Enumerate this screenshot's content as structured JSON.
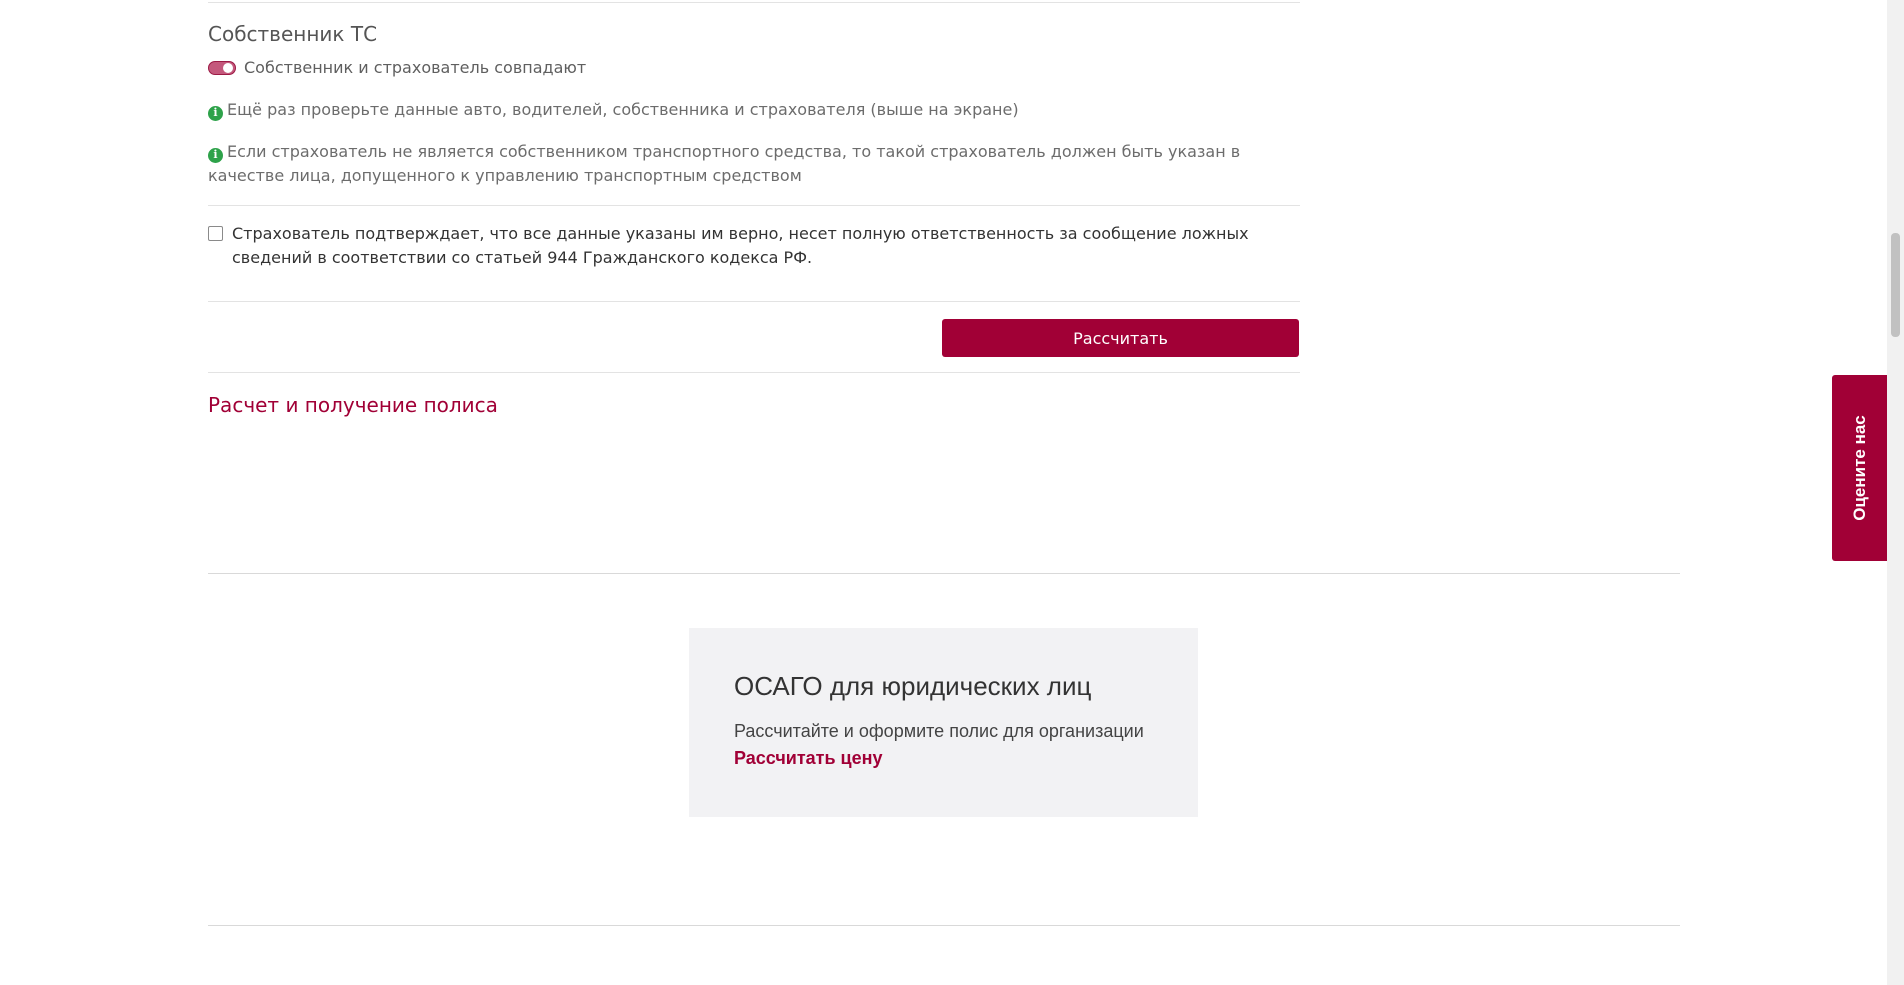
{
  "owner_section": {
    "title": "Собственник ТС",
    "toggle_label": "Собственник и страхователь совпадают",
    "toggle_on": true
  },
  "notes": [
    "Ещё раз проверьте данные авто, водителей, собственника и страхователя (выше на экране)",
    "Если страхователь не является собственником транспортного средства, то такой страхователь должен быть указан в качестве лица, допущенного к управлению транспортным средством"
  ],
  "confirmation": {
    "label": "Страхователь подтверждает, что все данные указаны им верно, несет полную ответственность за сообщение ложных сведений в соответствии со статьей 944 Гражданского кодекса РФ.",
    "checked": false
  },
  "actions": {
    "calculate_label": "Рассчитать"
  },
  "policy_section": {
    "title": "Расчет и получение полиса"
  },
  "legal_card": {
    "title": "ОСАГО для юридических лиц",
    "text": "Рассчитайте и оформите полис для организации",
    "link": "Рассчитать цену"
  },
  "feedback": {
    "label": "Оцените нас"
  },
  "colors": {
    "brand": "#a10036",
    "info": "#2ea24a",
    "card_bg": "#f2f2f4"
  }
}
